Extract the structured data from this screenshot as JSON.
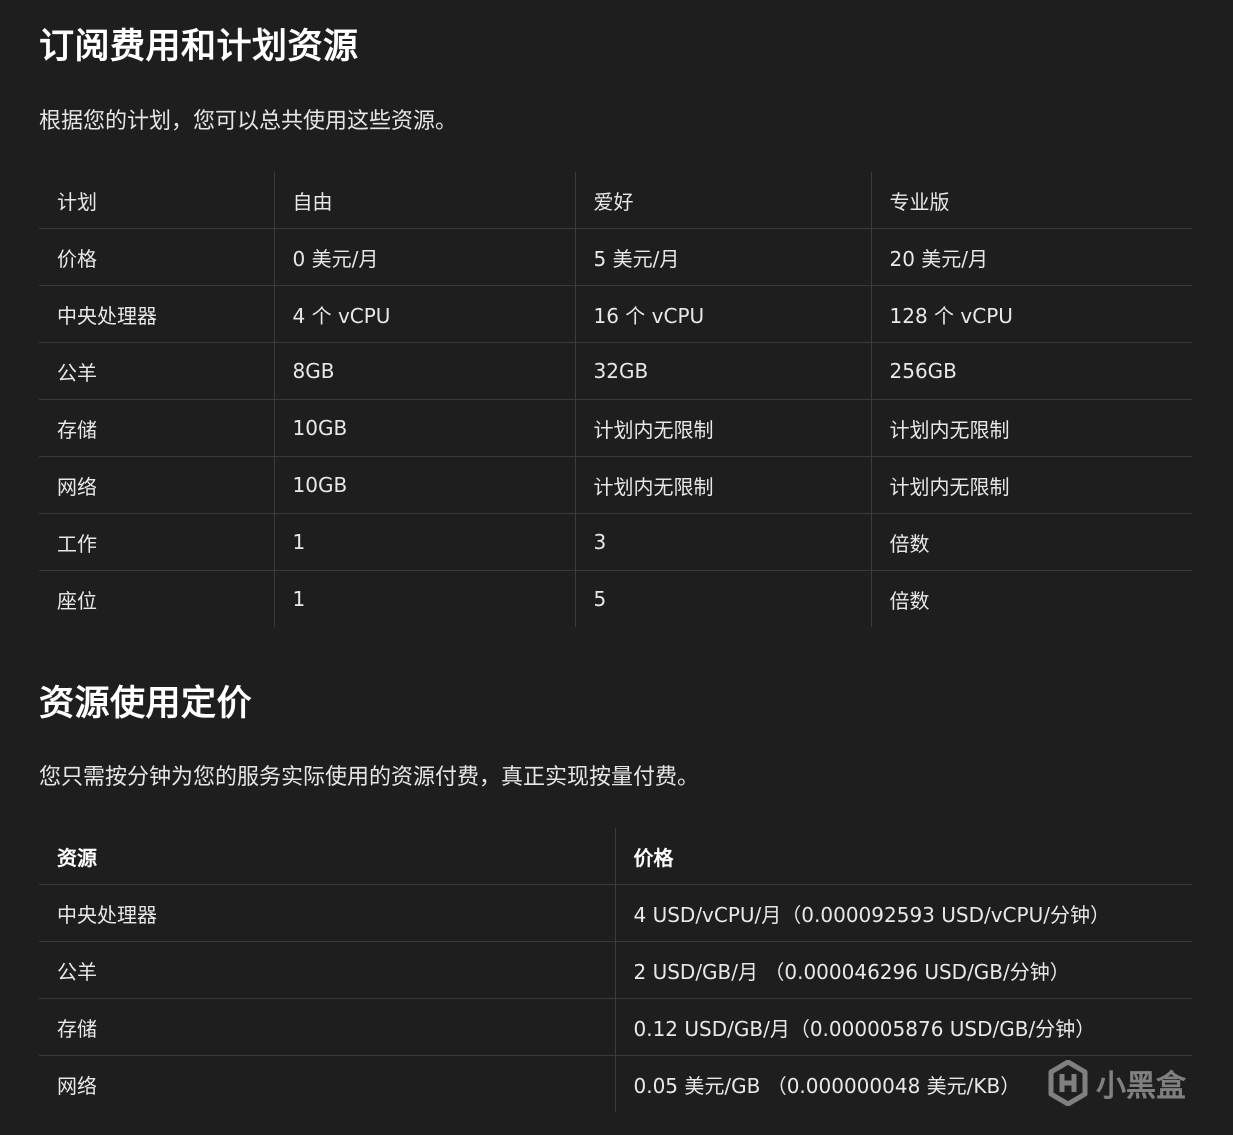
{
  "section1": {
    "title": "订阅费用和计划资源",
    "intro": "根据您的计划，您可以总共使用这些资源。",
    "headers": [
      "计划",
      "自由",
      "爱好",
      "专业版"
    ],
    "rows": [
      [
        "价格",
        "0 美元/月",
        "5 美元/月",
        "20 美元/月"
      ],
      [
        "中央处理器",
        "4 个 vCPU",
        "16 个 vCPU",
        "128 个 vCPU"
      ],
      [
        "公羊",
        "8GB",
        "32GB",
        "256GB"
      ],
      [
        "存储",
        "10GB",
        "计划内无限制",
        "计划内无限制"
      ],
      [
        "网络",
        "10GB",
        "计划内无限制",
        "计划内无限制"
      ],
      [
        "工作",
        "1",
        "3",
        "倍数"
      ],
      [
        "座位",
        "1",
        "5",
        "倍数"
      ]
    ]
  },
  "section2": {
    "title": "资源使用定价",
    "intro": "您只需按分钟为您的服务实际使用的资源付费，真正实现按量付费。",
    "headers": [
      "资源",
      "价格"
    ],
    "rows": [
      [
        "中央处理器",
        "4 USD/vCPU/月（0.000092593 USD/vCPU/分钟）"
      ],
      [
        "公羊",
        "2 USD/GB/月 （0.000046296 USD/GB/分钟）"
      ],
      [
        "存储",
        "0.12 USD/GB/月（0.000005876 USD/GB/分钟）"
      ],
      [
        "网络",
        "0.05 美元/GB （0.000000048 美元/KB）"
      ]
    ]
  },
  "watermark": {
    "text": "小黑盒",
    "icon": "heybox-logo-icon"
  }
}
